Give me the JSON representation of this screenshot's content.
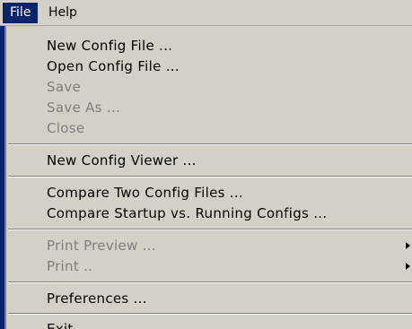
{
  "menubar": {
    "items": [
      {
        "label": "File"
      },
      {
        "label": "Help"
      }
    ]
  },
  "file_menu": {
    "items": [
      {
        "label": "New Config File ...",
        "enabled": true
      },
      {
        "label": "Open Config File ...",
        "enabled": true
      },
      {
        "label": "Save",
        "enabled": false
      },
      {
        "label": "Save As ...",
        "enabled": false
      },
      {
        "label": "Close",
        "enabled": false
      },
      {
        "label": "New Config Viewer ...",
        "enabled": true
      },
      {
        "label": "Compare Two Config Files ...",
        "enabled": true
      },
      {
        "label": "Compare Startup vs. Running Configs ...",
        "enabled": true
      },
      {
        "label": "Print Preview ...",
        "enabled": false,
        "submenu": true
      },
      {
        "label": "Print ..",
        "enabled": false,
        "submenu": true
      },
      {
        "label": "Preferences ...",
        "enabled": true
      },
      {
        "label": "Exit",
        "enabled": true
      }
    ]
  },
  "colors": {
    "menu_background": "#d4d0c8",
    "highlight": "#0a246a",
    "disabled_text": "#808080"
  }
}
